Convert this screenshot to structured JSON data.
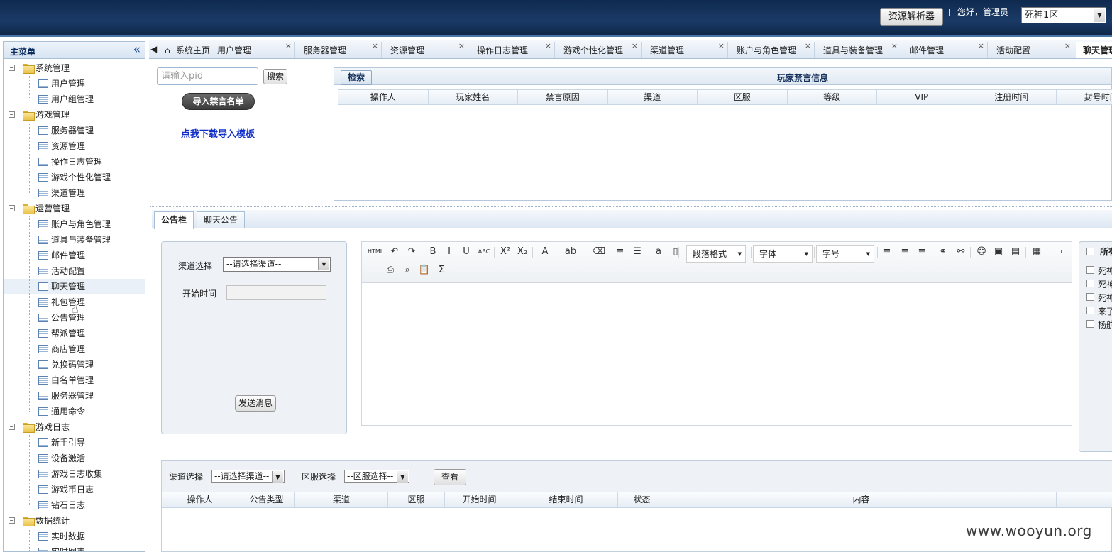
{
  "header": {
    "parser_button": "资源解析器",
    "greeting": "您好，管理员",
    "server_select": "死神1区"
  },
  "sidebar": {
    "title": "主菜单",
    "groups": [
      {
        "label": "系统管理",
        "items": [
          "用户管理",
          "用户组管理"
        ]
      },
      {
        "label": "游戏管理",
        "items": [
          "服务器管理",
          "资源管理",
          "操作日志管理",
          "游戏个性化管理",
          "渠道管理"
        ]
      },
      {
        "label": "运营管理",
        "items": [
          "账户与角色管理",
          "道具与装备管理",
          "邮件管理",
          "活动配置",
          "聊天管理",
          "礼包管理",
          "公告管理",
          "帮派管理",
          "商店管理",
          "兑换码管理",
          "白名单管理",
          "服务器管理",
          "通用命令"
        ]
      },
      {
        "label": "游戏日志",
        "items": [
          "新手引导",
          "设备激活",
          "游戏日志收集",
          "游戏币日志",
          "钻石日志"
        ]
      },
      {
        "label": "数据统计",
        "items": [
          "实时数据",
          "实时图表"
        ]
      }
    ]
  },
  "tabs": {
    "home": "系统主页",
    "list": [
      "用户管理",
      "服务器管理",
      "资源管理",
      "操作日志管理",
      "游戏个性化管理",
      "渠道管理",
      "账户与角色管理",
      "道具与装备管理",
      "邮件管理",
      "活动配置",
      "聊天管理"
    ],
    "active": "聊天管理"
  },
  "ban": {
    "pid_placeholder": "请输入pid",
    "search_button": "搜索",
    "import_button": "导入禁言名单",
    "download_link": "点我下载导入模板",
    "retrieve_button": "检索",
    "panel_title": "玩家禁言信息",
    "columns": [
      "操作人",
      "玩家姓名",
      "禁言原因",
      "渠道",
      "区服",
      "等级",
      "VIP",
      "注册时间",
      "封号时间"
    ]
  },
  "notice": {
    "tabs": [
      "公告栏",
      "聊天公告"
    ],
    "channel_label": "渠道选择",
    "channel_value": "--请选择渠道--",
    "start_label": "开始时间",
    "send_button": "发送消息",
    "editor": {
      "paragraph": "段落格式",
      "font": "字体",
      "size": "字号"
    },
    "server_list": {
      "all_label": "所有",
      "items": [
        "死神",
        "死神",
        "死神",
        "来了",
        "杨航"
      ]
    }
  },
  "query": {
    "channel_label": "渠道选择",
    "channel_value": "--请选择渠道--",
    "zone_label": "区服选择",
    "zone_value": "--区服选择--",
    "view_button": "查看",
    "columns": [
      "操作人",
      "公告类型",
      "渠道",
      "区服",
      "开始时间",
      "结束时间",
      "状态",
      "内容"
    ]
  },
  "watermark": "www.wooyun.org"
}
